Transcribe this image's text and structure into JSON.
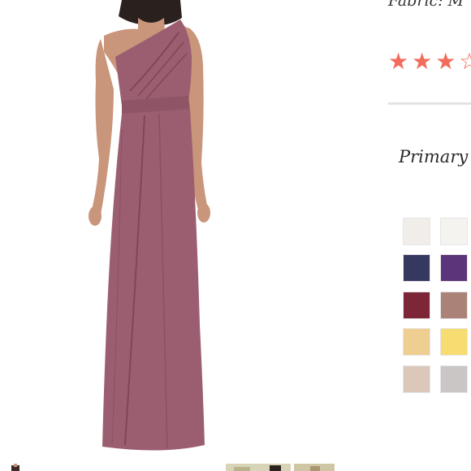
{
  "product": {
    "fabric_label": "Fabric: M",
    "rating": {
      "filled": 3,
      "partial": 1,
      "max": 5
    },
    "color_heading": "Primary",
    "image_alt": "One-shoulder draped maxi dress"
  },
  "colors": {
    "dress": "#9b5e70",
    "dress_shadow": "#7f4658",
    "skin": "#c9957b",
    "hair": "#2a211e",
    "star": "#f26b5b",
    "divider": "#e3e3e3"
  },
  "swatches": [
    {
      "name": "ivory",
      "color": "#f1eeea"
    },
    {
      "name": "white",
      "color": "#f4f3ef"
    },
    {
      "name": "navy",
      "color": "#35385f"
    },
    {
      "name": "plum",
      "color": "#5b3479"
    },
    {
      "name": "burgundy",
      "color": "#7c2638"
    },
    {
      "name": "mauve",
      "color": "#ab8278"
    },
    {
      "name": "honey",
      "color": "#eecf91"
    },
    {
      "name": "sunshine",
      "color": "#f7dc71"
    },
    {
      "name": "blush",
      "color": "#dcc7bb"
    },
    {
      "name": "silver",
      "color": "#c9c6c5"
    }
  ]
}
